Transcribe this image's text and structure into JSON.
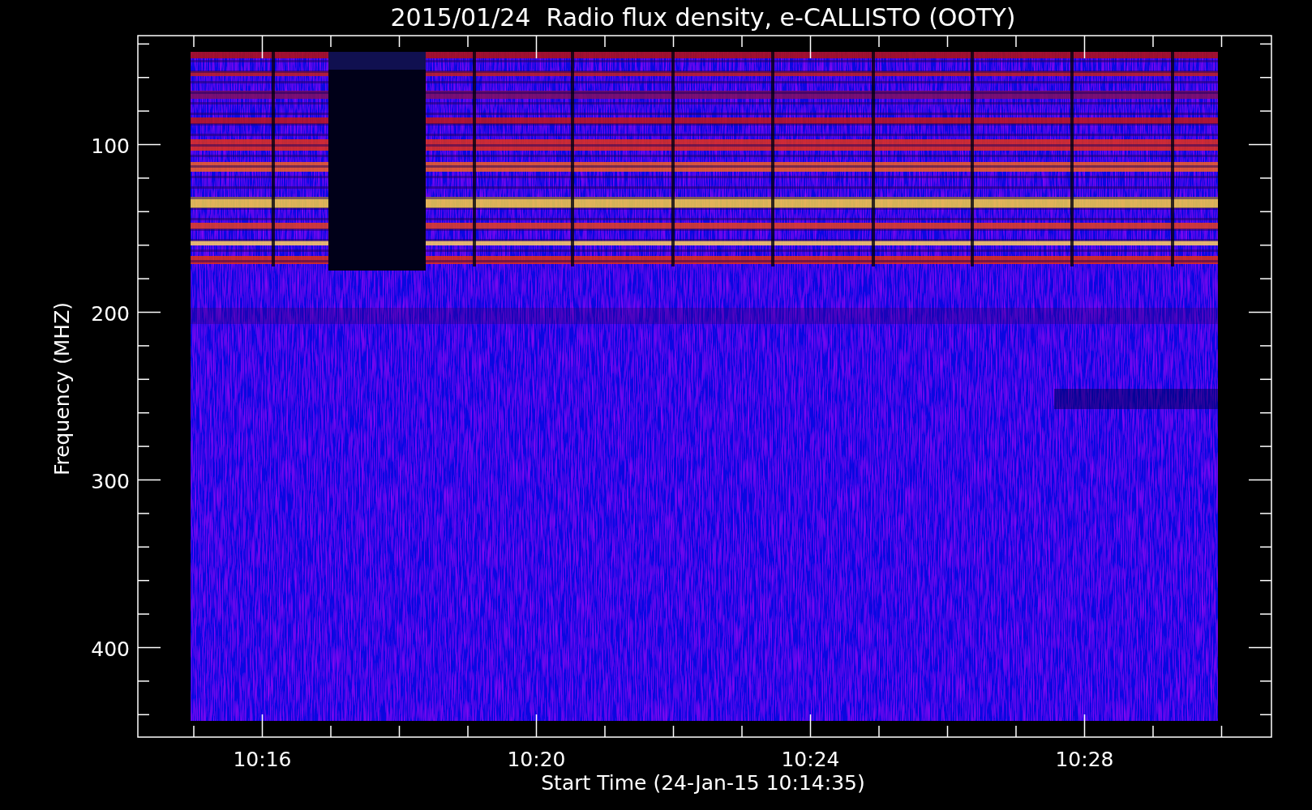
{
  "chart": {
    "title": "2015/01/24  Radio flux density, e-CALLISTO (OOTY)",
    "ylabel": "Frequency (MHZ)",
    "xlabel": "Start Time (24-Jan-15 10:14:35)",
    "yticks": [
      "100",
      "200",
      "300",
      "400"
    ],
    "xticks": [
      "10:16",
      "10:20",
      "10:24",
      "10:28"
    ]
  }
}
